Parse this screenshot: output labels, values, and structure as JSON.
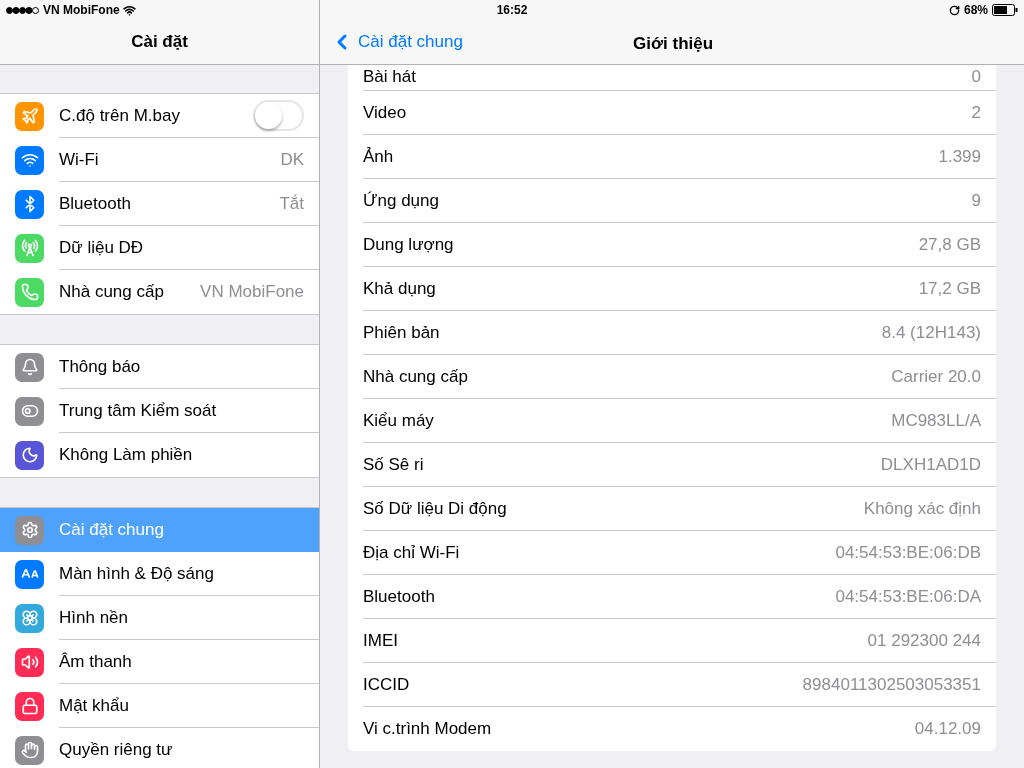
{
  "status_bar": {
    "carrier": "VN MobiFone",
    "time": "16:52",
    "battery": "68%"
  },
  "sidebar": {
    "title": "Cài đặt",
    "groups": [
      {
        "items": [
          {
            "kind": "toggle",
            "label": "C.độ trên M.bay",
            "on": false,
            "selected": false
          },
          {
            "kind": "link",
            "label": "Wi-Fi",
            "value": "DK",
            "selected": false
          },
          {
            "kind": "link",
            "label": "Bluetooth",
            "value": "Tắt",
            "selected": false
          },
          {
            "kind": "link",
            "label": "Dữ liệu DĐ",
            "selected": false
          },
          {
            "kind": "link",
            "label": "Nhà cung cấp",
            "value": "VN MobiFone",
            "selected": false
          }
        ]
      },
      {
        "items": [
          {
            "kind": "link",
            "label": "Thông báo",
            "selected": false
          },
          {
            "kind": "link",
            "label": "Trung tâm Kiểm soát",
            "selected": false
          },
          {
            "kind": "link",
            "label": "Không Làm phiền",
            "selected": false
          }
        ]
      },
      {
        "items": [
          {
            "kind": "link",
            "label": "Cài đặt chung",
            "selected": true
          },
          {
            "kind": "link",
            "label": "Màn hình & Độ sáng",
            "selected": false
          },
          {
            "kind": "link",
            "label": "Hình nền",
            "selected": false
          },
          {
            "kind": "link",
            "label": "Âm thanh",
            "selected": false
          },
          {
            "kind": "link",
            "label": "Mật khẩu",
            "selected": false
          },
          {
            "kind": "link",
            "label": "Quyền riêng tư",
            "selected": false
          }
        ]
      }
    ]
  },
  "detail": {
    "back": "Cài đặt chung",
    "title": "Giới thiệu",
    "rows": [
      {
        "label": "Bài hát",
        "value": "0"
      },
      {
        "label": "Video",
        "value": "2"
      },
      {
        "label": "Ảnh",
        "value": "1.399"
      },
      {
        "label": "Ứng dụng",
        "value": "9"
      },
      {
        "label": "Dung lượng",
        "value": "27,8 GB"
      },
      {
        "label": "Khả dụng",
        "value": "17,2 GB"
      },
      {
        "label": "Phiên bản",
        "value": "8.4 (12H143)"
      },
      {
        "label": "Nhà cung cấp",
        "value": "Carrier 20.0"
      },
      {
        "label": "Kiểu máy",
        "value": "MC983LL/A"
      },
      {
        "label": "Số Sê ri",
        "value": "DLXH1AD1D"
      },
      {
        "label": "Số Dữ liệu Di động",
        "value": "Không xác định"
      },
      {
        "label": "Địa chỉ Wi-Fi",
        "value": "04:54:53:BE:06:DB"
      },
      {
        "label": "Bluetooth",
        "value": "04:54:53:BE:06:DA"
      },
      {
        "label": "IMEI",
        "value": "01 292300 244"
      },
      {
        "label": "ICCID",
        "value": "8984011302503053351"
      },
      {
        "label": "Vi c.trình Modem",
        "value": "04.12.09"
      }
    ]
  }
}
